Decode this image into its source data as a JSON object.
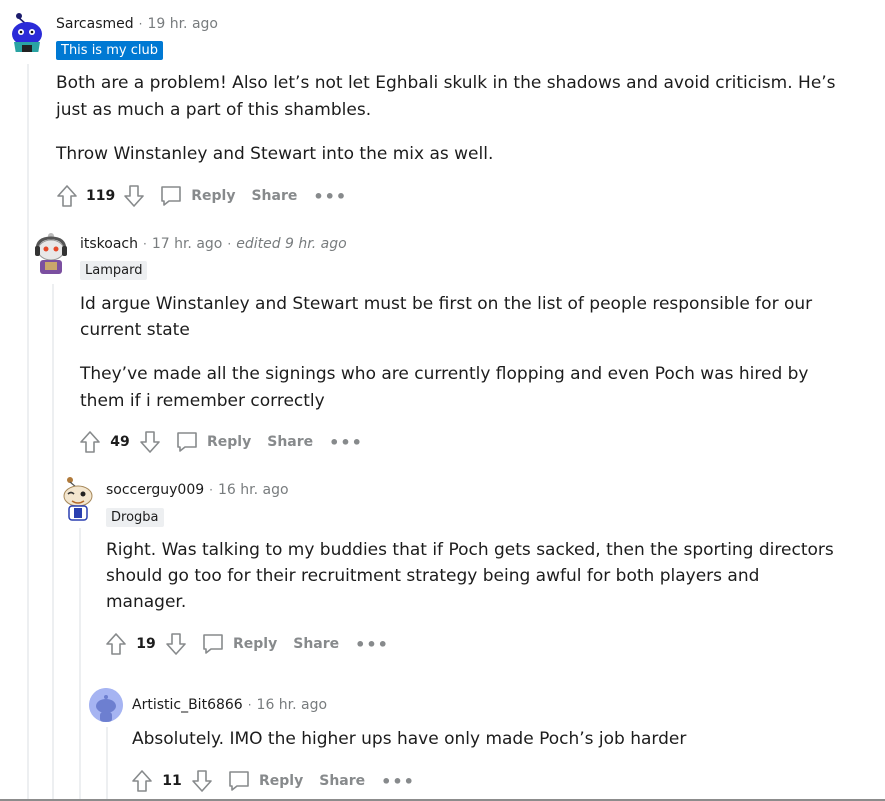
{
  "actions": {
    "reply": "Reply",
    "share": "Share",
    "more": "•••"
  },
  "colors": {
    "flair_blue": "#0079d3",
    "flair_grey": "#edeff1",
    "meta": "#787c7e",
    "action": "#878a8c"
  },
  "comments": [
    {
      "author": "Sarcasmed",
      "time": "19 hr. ago",
      "edited": "",
      "flair": "This is my club",
      "paragraphs": [
        "Both are a problem! Also let’s not let Eghbali skulk in the shadows and avoid criticism. He’s",
        "just as much a part of this shambles.",
        "Throw Winstanley and Stewart into the mix as well."
      ],
      "score": "119",
      "avatar_icon": "snoo-avatar-blue"
    },
    {
      "author": "itskoach",
      "time": "17 hr. ago",
      "edited": "edited 9 hr. ago",
      "flair": "Lampard",
      "paragraphs": [
        "Id argue Winstanley and Stewart must be first on the list of people responsible for our",
        "current state",
        "They’ve made all the signings who are currently flopping and even Poch was hired by",
        "them if i remember correctly"
      ],
      "score": "49",
      "avatar_icon": "snoo-avatar-headphones"
    },
    {
      "author": "soccerguy009",
      "time": "16 hr. ago",
      "edited": "",
      "flair": "Drogba",
      "paragraphs": [
        "Right. Was talking to my buddies that if Poch gets sacked, then the sporting directors",
        "should go too for their recruitment strategy being awful for both players and",
        "manager."
      ],
      "score": "19",
      "avatar_icon": "snoo-avatar-wink"
    },
    {
      "author": "Artistic_Bit6866",
      "time": "16 hr. ago",
      "edited": "",
      "flair": "",
      "paragraphs": [
        "Absolutely. IMO the higher ups have only made Poch’s job harder"
      ],
      "score": "11",
      "avatar_icon": "default-avatar"
    }
  ]
}
